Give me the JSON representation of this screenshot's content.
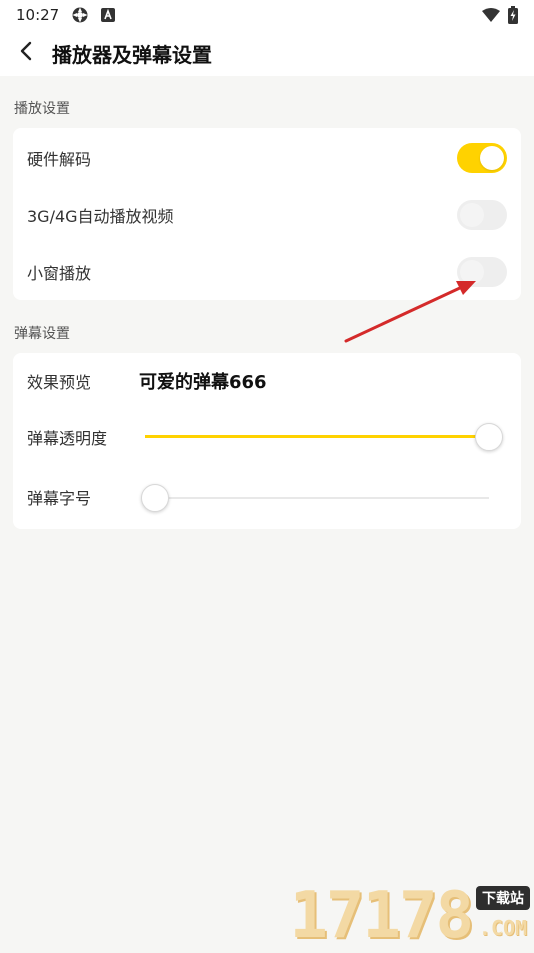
{
  "status_bar": {
    "time": "10:27",
    "icons_left": [
      "sync-icon",
      "a-badge-icon"
    ],
    "icons_right": [
      "wifi-icon",
      "battery-charging-icon"
    ]
  },
  "header": {
    "title": "播放器及弹幕设置",
    "back_icon": "chevron-left-icon"
  },
  "playback_section": {
    "label": "播放设置",
    "items": [
      {
        "label": "硬件解码",
        "enabled": true
      },
      {
        "label": "3G/4G自动播放视频",
        "enabled": false
      },
      {
        "label": "小窗播放",
        "enabled": false
      }
    ]
  },
  "danmaku_section": {
    "label": "弹幕设置",
    "preview_label": "效果预览",
    "preview_text": "可爱的弹幕666",
    "opacity_label": "弹幕透明度",
    "opacity_value": 1.0,
    "font_size_label": "弹幕字号",
    "font_size_value": 0.0
  },
  "watermark": {
    "number": "17178",
    "badge": "下载站",
    "domain": ".COM"
  },
  "colors": {
    "accent": "#ffd200",
    "background": "#f6f6f4",
    "card": "#ffffff",
    "annotation_arrow": "#d42a2a"
  }
}
